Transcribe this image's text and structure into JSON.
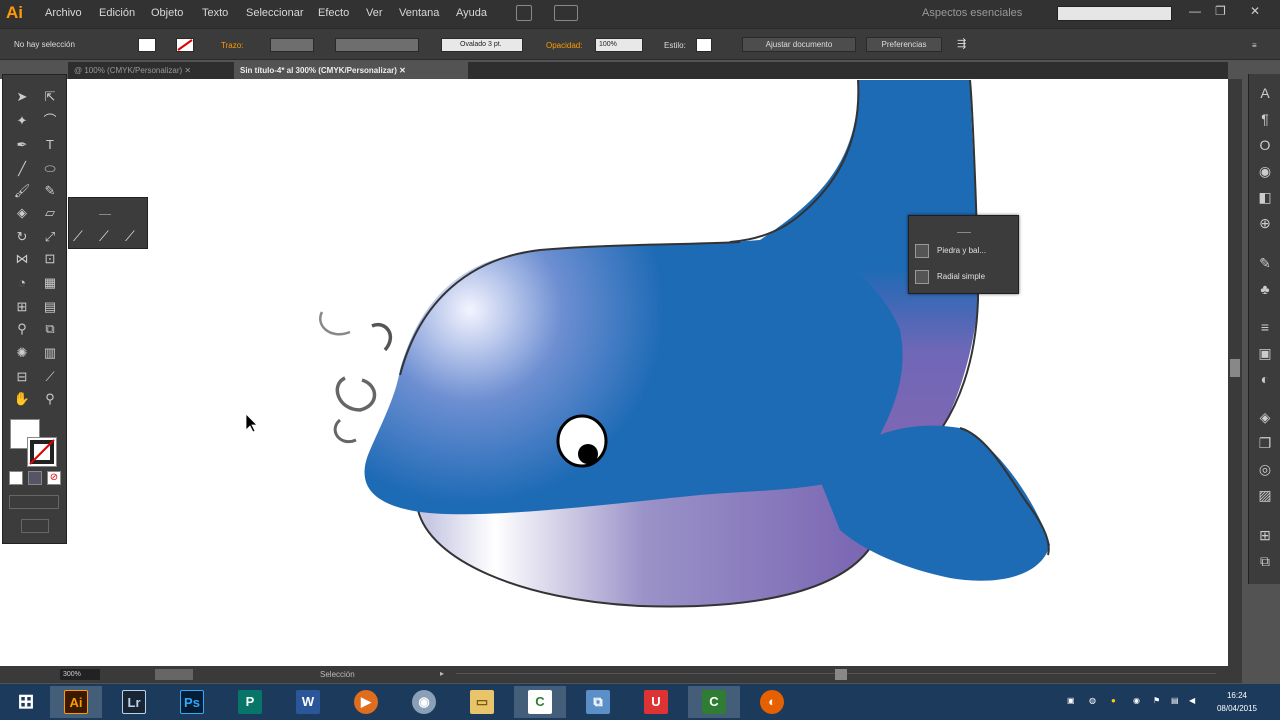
{
  "app": {
    "logo_text": "Ai",
    "accent": "#ff9a00"
  },
  "menu": [
    "Archivo",
    "Edición",
    "Objeto",
    "Texto",
    "Seleccionar",
    "Efecto",
    "Ver",
    "Ventana",
    "Ayuda"
  ],
  "workspace_label": "Aspectos esenciales",
  "control_bar": {
    "selection_status": "No hay selección",
    "stroke_label": "Trazo:",
    "brush_value": "Ovalado 3 pt.",
    "opacity_label": "Opacidad:",
    "opacity_value": "100%",
    "style_label": "Estilo:",
    "doc_setup": "Ajustar documento",
    "preferences": "Preferencias"
  },
  "tabs": [
    {
      "label": "@ 100% (CMYK/Personalizar)",
      "active": false
    },
    {
      "label": "Sin título-4* al 300% (CMYK/Personalizar)",
      "active": true
    }
  ],
  "gradient_panel": {
    "items": [
      {
        "label": "Piedra y bal..."
      },
      {
        "label": "Radial simple"
      }
    ]
  },
  "status_bar": {
    "zoom_value": "300%",
    "tool_name": "Selección"
  },
  "tray": {
    "time": "16:24",
    "date": "08/04/2015"
  },
  "colors": {
    "whale_blue": "#1d6ab5",
    "whale_purple": "#7b67b3",
    "canvas_bg": "#ffffff",
    "ui_dark": "#3c3c3c"
  }
}
